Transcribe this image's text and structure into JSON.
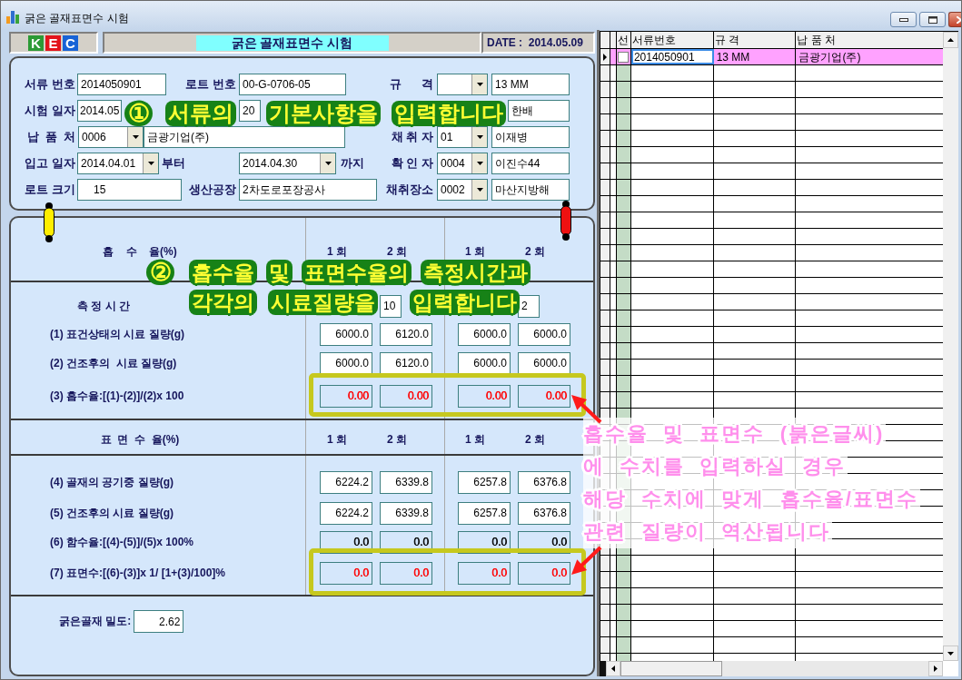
{
  "window": {
    "title": "굵은 골재표면수 시험"
  },
  "header": {
    "logo": [
      {
        "letter": "K",
        "color": "#2c9a35"
      },
      {
        "letter": "E",
        "color": "#e3141b"
      },
      {
        "letter": "C",
        "color": "#1863d6"
      }
    ],
    "title": "굵은 골재표면수 시험",
    "date": "DATE :  2014.05.09"
  },
  "form": {
    "document_no": {
      "label": "서류 번호",
      "value": "2014050901"
    },
    "lot_no": {
      "label": "로트 번호",
      "value": "00-G-0706-05"
    },
    "test_date": {
      "label": "시험 일자",
      "value": "2014.05"
    },
    "unlabeled_field": {
      "value": "20"
    },
    "supplier": {
      "label": "납  품  처",
      "code": "0006",
      "name": "금광기업(주)"
    },
    "receipt_date": {
      "label": "입고 일자",
      "from": "2014.04.01",
      "from_suffix": "부터",
      "to": "2014.04.30",
      "to_suffix": "까지"
    },
    "lot_size": {
      "label": "로트 크기",
      "value": "15"
    },
    "plant": {
      "label": "생산공장",
      "value": "2차도로포장공사"
    },
    "right": [
      {
        "kind": "combo",
        "label": "규      격",
        "value": "13 MM"
      },
      {
        "kind": "text",
        "value": "한배"
      },
      {
        "kind": "combo",
        "label": "채 취 자",
        "code": "01",
        "value": "이재병"
      },
      {
        "kind": "combo",
        "label": "확 인 자",
        "code": "0004",
        "value": "이진수44"
      },
      {
        "kind": "combo",
        "label": "채취장소",
        "code": "0002",
        "value": "마산지방해"
      }
    ]
  },
  "absorption": {
    "title": "흡    수    율(%)",
    "columns": [
      "1 회",
      "2 회",
      "1 회",
      "2 회"
    ],
    "rows": [
      {
        "kind": "time",
        "label": "측 정 시 간",
        "highlighted": false,
        "cells": [
          {
            "kind": "hidden"
          },
          {
            "kind": "time",
            "value": "10"
          },
          {
            "kind": "hidden"
          },
          {
            "kind": "time",
            "value": "2"
          }
        ]
      },
      {
        "kind": "measure",
        "label": "(1) 표건상태의 시료 질량(g)",
        "highlighted": false,
        "cells": [
          {
            "kind": "input",
            "value": "6000.0"
          },
          {
            "kind": "input",
            "value": "6120.0"
          },
          {
            "kind": "input",
            "value": "6000.0"
          },
          {
            "kind": "input",
            "value": "6000.0"
          }
        ]
      },
      {
        "kind": "measure",
        "label": "(2) 건조후의  시료 질량(g)",
        "highlighted": false,
        "cells": [
          {
            "kind": "input",
            "value": "6000.0"
          },
          {
            "kind": "input",
            "value": "6120.0"
          },
          {
            "kind": "input",
            "value": "6000.0"
          },
          {
            "kind": "input",
            "value": "6000.0"
          }
        ]
      },
      {
        "kind": "measure",
        "label": "(3) 흡수율:[(1)-(2)]/(2)x 100",
        "highlighted": true,
        "cells": [
          {
            "kind": "calc",
            "value": "0.00",
            "color": "#ff0000"
          },
          {
            "kind": "calc",
            "value": "0.00",
            "color": "#ff0000"
          },
          {
            "kind": "calc",
            "value": "0.00",
            "color": "#ff0000"
          },
          {
            "kind": "calc",
            "value": "0.00",
            "color": "#ff0000"
          }
        ]
      }
    ]
  },
  "surface_moisture": {
    "title": "표  면  수  율(%)",
    "columns": [
      "1 회",
      "2 회",
      "1 회",
      "2 회"
    ],
    "rows": [
      {
        "kind": "measure",
        "label": "(4) 골재의 공기중 질량(g)",
        "highlighted": false,
        "cells": [
          {
            "kind": "input",
            "value": "6224.2"
          },
          {
            "kind": "input",
            "value": "6339.8"
          },
          {
            "kind": "input",
            "value": "6257.8"
          },
          {
            "kind": "input",
            "value": "6376.8"
          }
        ]
      },
      {
        "kind": "measure",
        "label": "(5) 건조후의 시료 질량(g)",
        "highlighted": false,
        "cells": [
          {
            "kind": "input",
            "value": "6224.2"
          },
          {
            "kind": "input",
            "value": "6339.8"
          },
          {
            "kind": "input",
            "value": "6257.8"
          },
          {
            "kind": "input",
            "value": "6376.8"
          }
        ]
      },
      {
        "kind": "measure",
        "label": "(6) 함수율:[(4)-(5)]/(5)x 100%",
        "highlighted": false,
        "cells": [
          {
            "kind": "calc",
            "value": "0.0",
            "color": "#000000"
          },
          {
            "kind": "calc",
            "value": "0.0",
            "color": "#000000"
          },
          {
            "kind": "calc",
            "value": "0.0",
            "color": "#000000"
          },
          {
            "kind": "calc",
            "value": "0.0",
            "color": "#000000"
          }
        ]
      },
      {
        "kind": "measure",
        "label": "(7) 표면수:[(6)-(3)]x 1/ [1+(3)/100]%",
        "highlighted": true,
        "cells": [
          {
            "kind": "calc",
            "value": "0.0",
            "color": "#ff0000"
          },
          {
            "kind": "calc",
            "value": "0.0",
            "color": "#ff0000"
          },
          {
            "kind": "calc",
            "value": "0.0",
            "color": "#ff0000"
          },
          {
            "kind": "calc",
            "value": "0.0",
            "color": "#ff0000"
          }
        ]
      }
    ]
  },
  "density": {
    "label": "굵은골재 밀도:",
    "value": "2.62"
  },
  "grid": {
    "columns": [
      "선",
      "서류번호",
      "규 격",
      "납 품 처"
    ],
    "rows": [
      {
        "selected": true,
        "cells": [
          {
            "kind": "check",
            "checked": false
          },
          {
            "kind": "text",
            "value": "2014050901"
          },
          {
            "kind": "text",
            "value": "13 MM"
          },
          {
            "kind": "text",
            "value": "금광기업(주)"
          }
        ]
      }
    ]
  },
  "callouts": [
    {
      "kind": "numbered",
      "number": "①",
      "lines": [
        "서류의 기본사항을 입력합니다"
      ]
    },
    {
      "kind": "numbered",
      "number": "②",
      "lines": [
        "흡수율 및 표면수율의 측정시간과",
        "각각의 시료질량을 입력합니다"
      ]
    },
    {
      "kind": "note",
      "lines": [
        "흡수율  및  표면수  (붉은글씨)",
        "에  수치를  입력하실  경우",
        "해당  수치에  맞게  흡수율/표면수",
        "관련  질량이  역산됩니다"
      ]
    }
  ]
}
